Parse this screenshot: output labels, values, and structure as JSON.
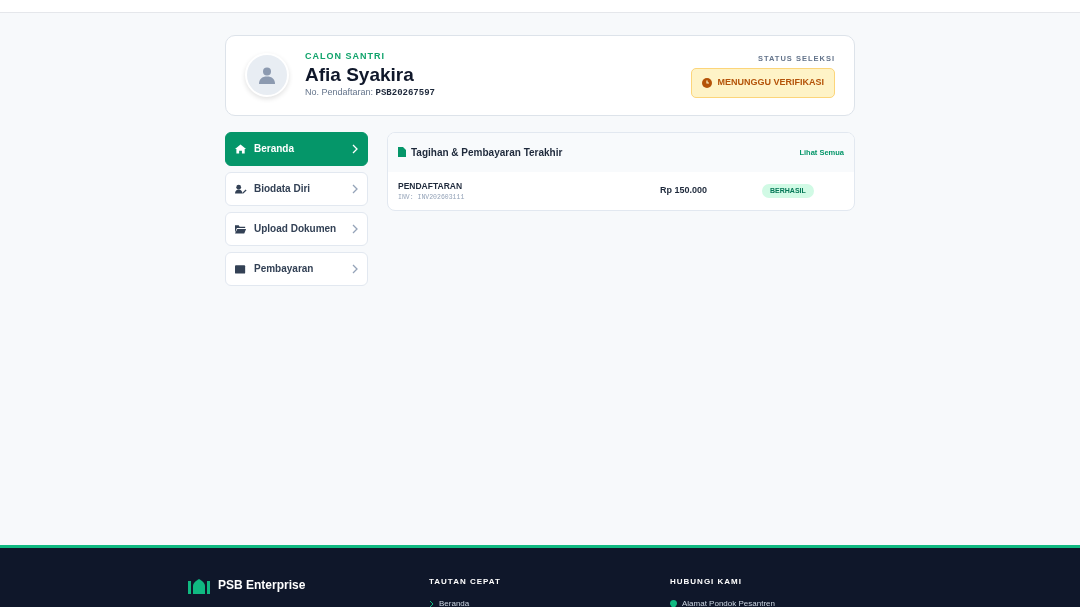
{
  "profile": {
    "eyebrow": "CALON SANTRI",
    "name": "Afia Syakira",
    "reg_label": "No. Pendaftaran:",
    "reg_number": "PSB20267597",
    "status_label": "STATUS SELEKSI",
    "status": "MENUNGGU VERIFIKASI"
  },
  "menu": [
    {
      "label": "Beranda",
      "selected": true
    },
    {
      "label": "Biodata Diri",
      "selected": false
    },
    {
      "label": "Upload Dokumen",
      "selected": false
    },
    {
      "label": "Pembayaran",
      "selected": false
    }
  ],
  "bills": {
    "title": "Tagihan & Pembayaran Terakhir",
    "link": "Lihat Semua",
    "rows": [
      {
        "name": "PENDAFTARAN",
        "invoice": "INV: INV202603111",
        "amount": "Rp 150.000",
        "status": "BERHASIL",
        "kind": "success"
      }
    ]
  },
  "footer": {
    "brand": "PSB Enterprise",
    "links_title": "TAUTAN CEPAT",
    "links": [
      "Beranda"
    ],
    "contact_title": "HUBUNGI KAMI",
    "contacts": [
      "Alamat Pondok Pesantren"
    ]
  }
}
